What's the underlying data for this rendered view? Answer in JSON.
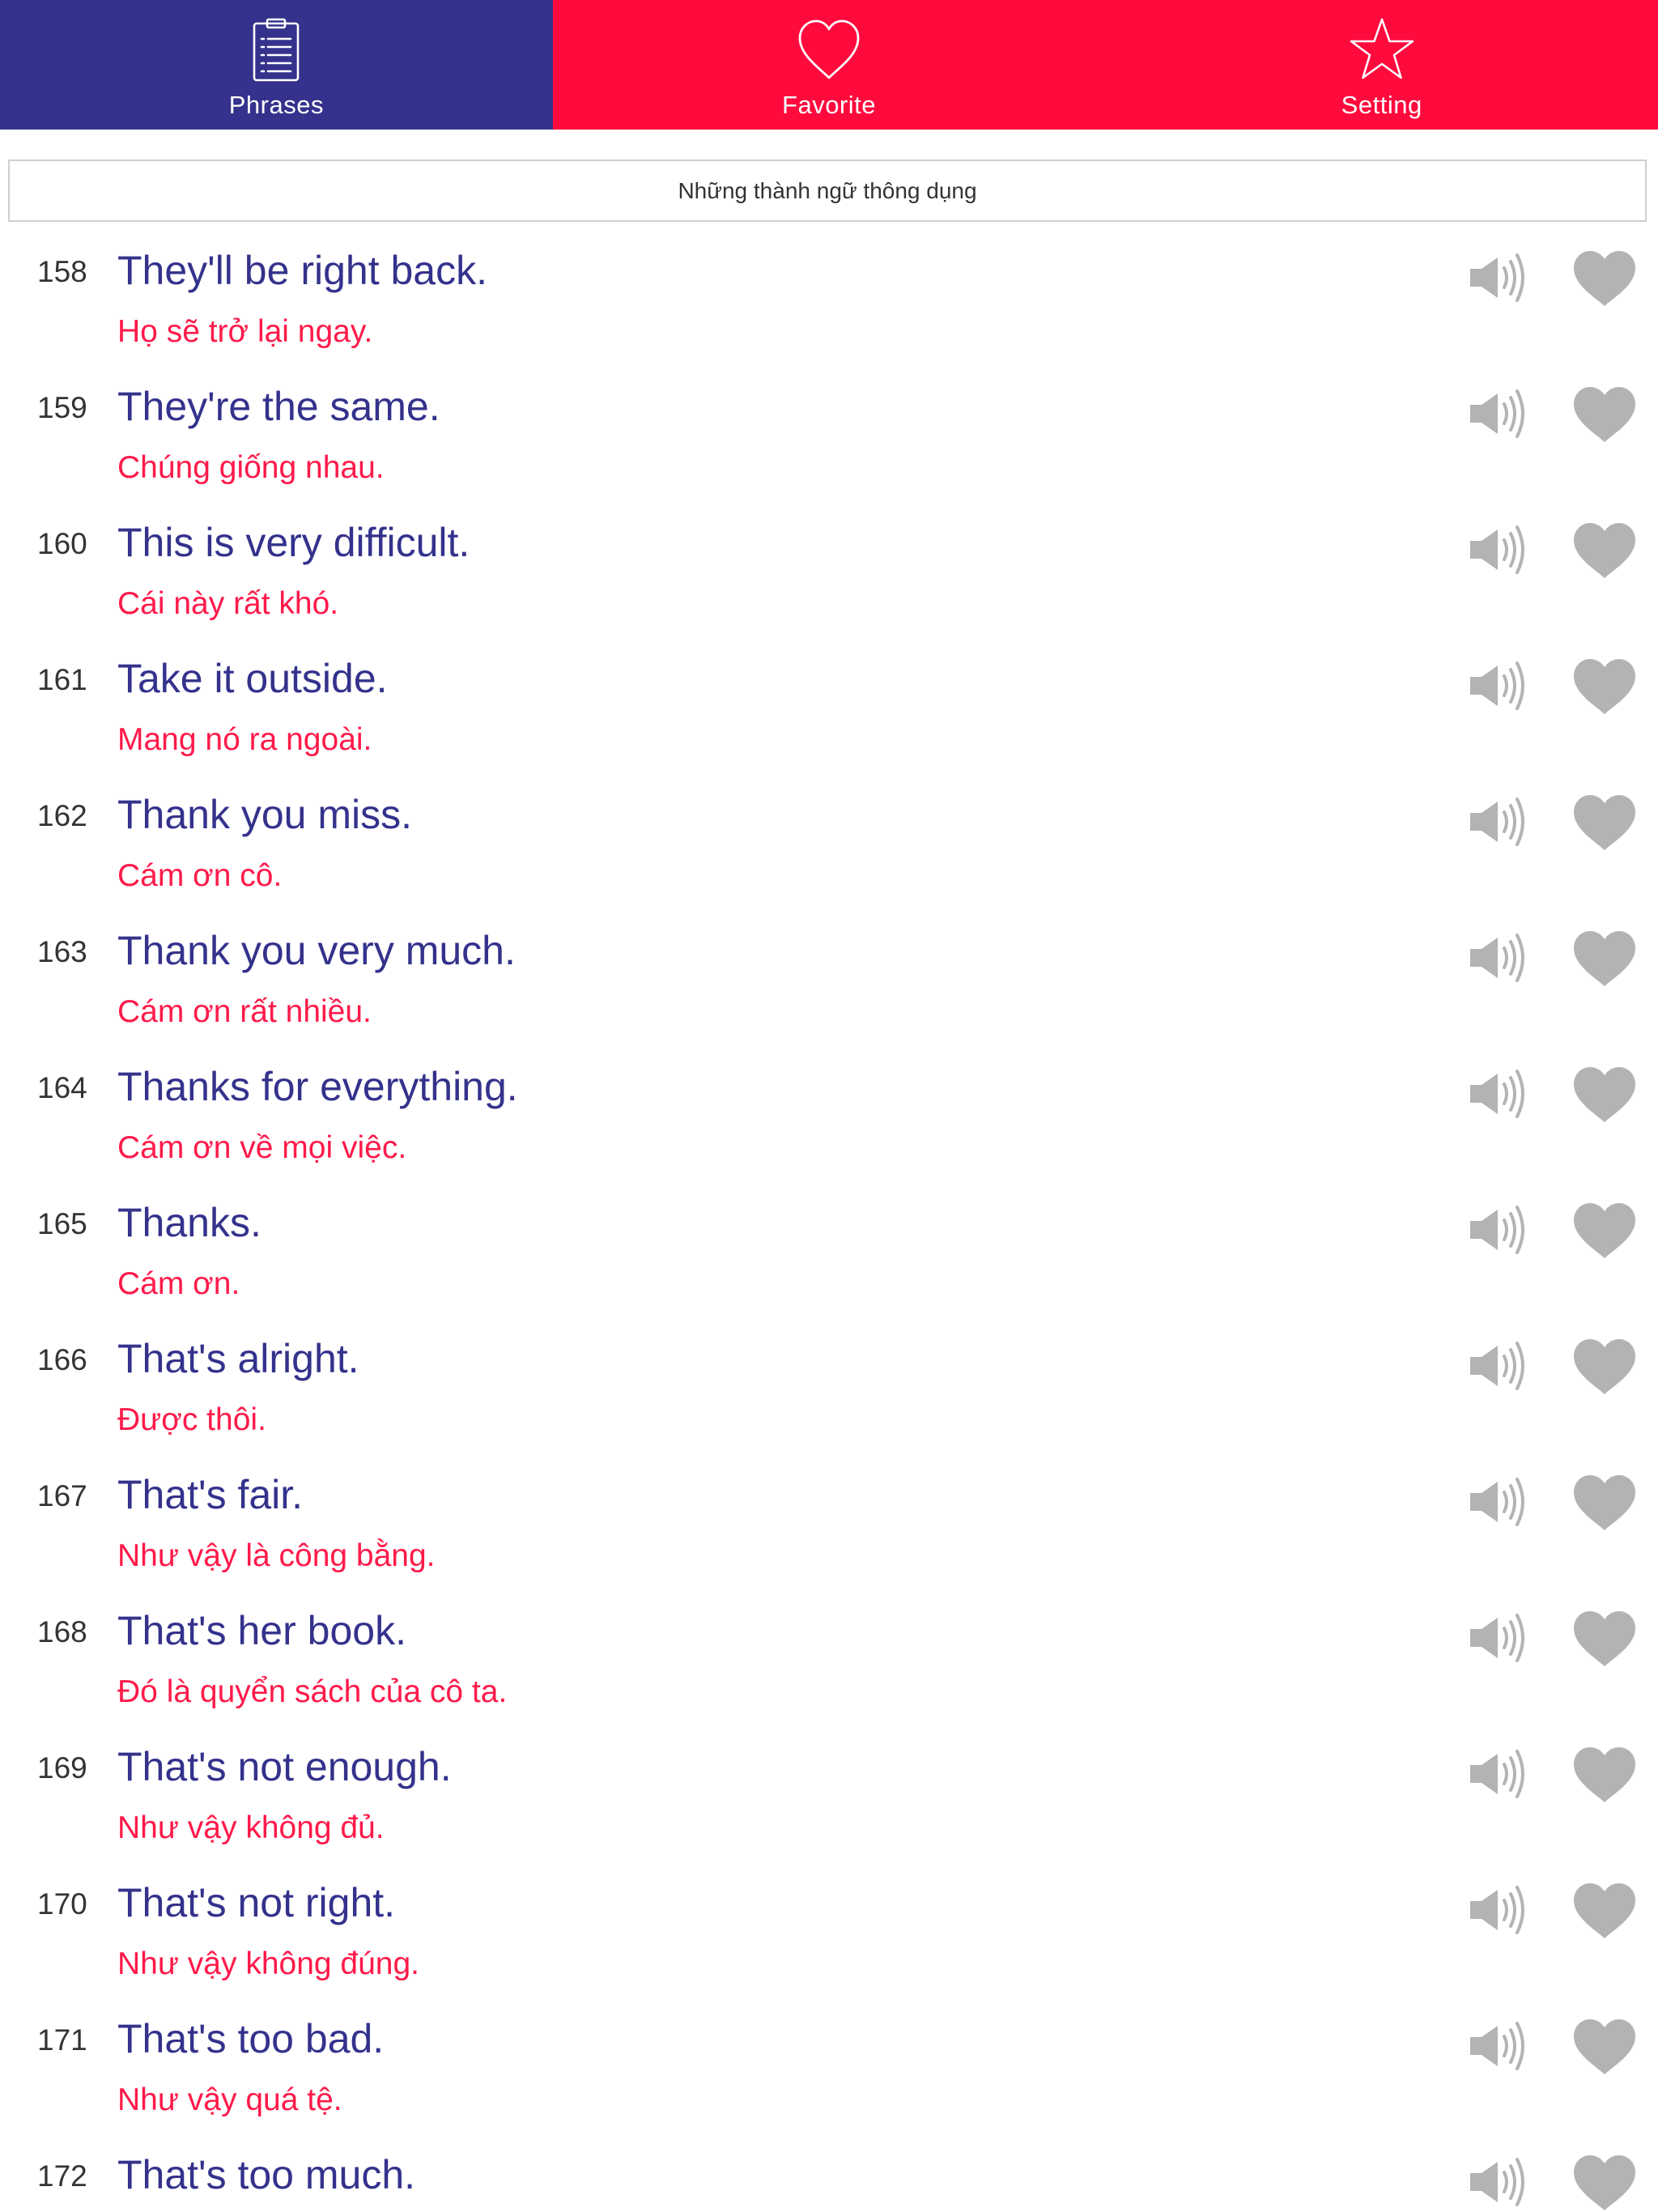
{
  "tabs": [
    {
      "label": "Phrases",
      "icon": "clipboard-list-icon",
      "active": true
    },
    {
      "label": "Favorite",
      "icon": "heart-outline-icon",
      "active": false
    },
    {
      "label": "Setting",
      "icon": "star-outline-icon",
      "active": false
    }
  ],
  "section": {
    "title": "Những thành ngữ thông dụng"
  },
  "colors": {
    "tab_active": "#34328c",
    "tab_bar": "#ff0a3d",
    "english_text": "#34328c",
    "vietnamese_text": "#ff1a4a",
    "icon_gray": "#b3b3b3"
  },
  "phrases": [
    {
      "number": "158",
      "en": "They'll be right back.",
      "vi": "Họ sẽ trở lại ngay."
    },
    {
      "number": "159",
      "en": "They're the same.",
      "vi": "Chúng giống nhau."
    },
    {
      "number": "160",
      "en": "This is very difficult.",
      "vi": "Cái này rất khó."
    },
    {
      "number": "161",
      "en": "Take it outside.",
      "vi": "Mang nó ra ngoài."
    },
    {
      "number": "162",
      "en": "Thank you miss.",
      "vi": "Cám ơn cô."
    },
    {
      "number": "163",
      "en": "Thank you very much.",
      "vi": "Cám ơn rất nhiều."
    },
    {
      "number": "164",
      "en": "Thanks for everything.",
      "vi": "Cám ơn về mọi việc."
    },
    {
      "number": "165",
      "en": "Thanks.",
      "vi": "Cám ơn."
    },
    {
      "number": "166",
      "en": "That's alright.",
      "vi": "Được thôi."
    },
    {
      "number": "167",
      "en": "That's fair.",
      "vi": "Như vậy là công bằng."
    },
    {
      "number": "168",
      "en": "That's her book.",
      "vi": "Đó là quyển sách của cô ta."
    },
    {
      "number": "169",
      "en": "That's not enough.",
      "vi": "Như vậy không đủ."
    },
    {
      "number": "170",
      "en": "That's not right.",
      "vi": "Như vậy không đúng."
    },
    {
      "number": "171",
      "en": "That's too bad.",
      "vi": "Như vậy quá tệ."
    },
    {
      "number": "172",
      "en": "That's too much.",
      "vi": ""
    }
  ]
}
